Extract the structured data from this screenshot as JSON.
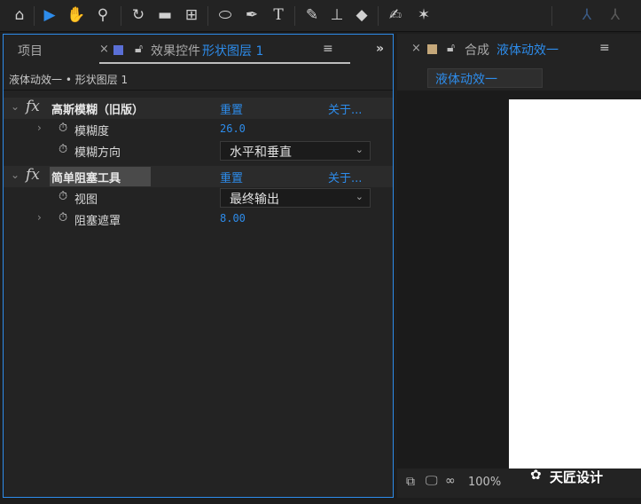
{
  "toolbar": {
    "tools": [
      {
        "name": "home-icon",
        "glyph": "⌂"
      },
      {
        "name": "selection-tool-icon",
        "glyph": "▶"
      },
      {
        "name": "hand-tool-icon",
        "glyph": "✋"
      },
      {
        "name": "zoom-tool-icon",
        "glyph": "⚲"
      },
      {
        "name": "rotate-tool-icon",
        "glyph": "↻"
      },
      {
        "name": "camera-tool-icon",
        "glyph": "▬"
      },
      {
        "name": "pan-behind-tool-icon",
        "glyph": "⊞"
      },
      {
        "name": "ellipse-tool-icon",
        "glyph": "⬭"
      },
      {
        "name": "pen-tool-icon",
        "glyph": "✒"
      },
      {
        "name": "type-tool-icon",
        "glyph": "T"
      },
      {
        "name": "brush-tool-icon",
        "glyph": "✎"
      },
      {
        "name": "clone-stamp-tool-icon",
        "glyph": "⊥"
      },
      {
        "name": "eraser-tool-icon",
        "glyph": "◆"
      },
      {
        "name": "roto-brush-tool-icon",
        "glyph": "✍"
      },
      {
        "name": "puppet-tool-icon",
        "glyph": "✶"
      },
      {
        "name": "axis-tool-icon",
        "glyph": "⅄"
      }
    ]
  },
  "left_panel": {
    "tab_project": "项目",
    "tab_close": "×",
    "tab_effect_controls": "效果控件",
    "tab_layer_name": "形状图层 1",
    "tab_menu": "≡",
    "overflow": "»",
    "breadcrumb": "液体动效一 • 形状图层 1"
  },
  "effects": [
    {
      "name": "高斯模糊（旧版）",
      "reset": "重置",
      "about": "关于...",
      "props": [
        {
          "label": "模糊度",
          "value": "26.0",
          "type": "number"
        },
        {
          "label": "模糊方向",
          "value": "水平和垂直",
          "type": "dropdown"
        }
      ]
    },
    {
      "name": "简单阻塞工具",
      "reset": "重置",
      "about": "关于...",
      "props": [
        {
          "label": "视图",
          "value": "最终输出",
          "type": "dropdown"
        },
        {
          "label": "阻塞遮罩",
          "value": "8.00",
          "type": "number"
        }
      ]
    }
  ],
  "right_panel": {
    "tab_close": "×",
    "tab_label": "合成",
    "comp_name": "液体动效一",
    "tab_menu": "≡",
    "comp_tab": "液体动效一",
    "zoom": "100%",
    "watermark": "天匠设计"
  },
  "colors": {
    "accent": "#2d8ceb",
    "effect_label_color": "#5a6fd6",
    "comp_label_color": "#c5a87a"
  }
}
